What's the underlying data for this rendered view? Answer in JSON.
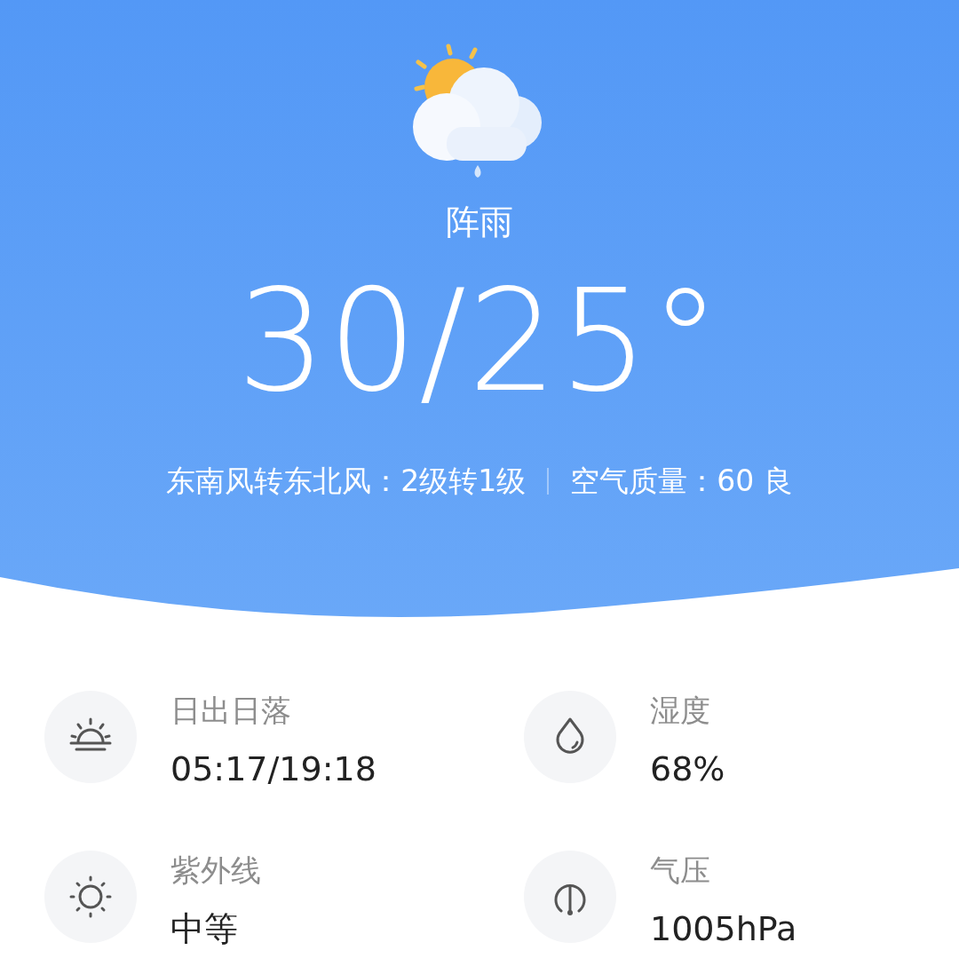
{
  "current": {
    "condition": "阵雨",
    "temperature": "30/25°",
    "wind": "东南风转东北风：2级转1级",
    "air_quality": "空气质量：60 良"
  },
  "details": [
    {
      "kind": "sunrise",
      "label": "日出日落",
      "value": "05:17/19:18"
    },
    {
      "kind": "humidity",
      "label": "湿度",
      "value": "68%"
    },
    {
      "kind": "uv",
      "label": "紫外线",
      "value": "中等"
    },
    {
      "kind": "pressure",
      "label": "气压",
      "value": "1005hPa"
    }
  ]
}
